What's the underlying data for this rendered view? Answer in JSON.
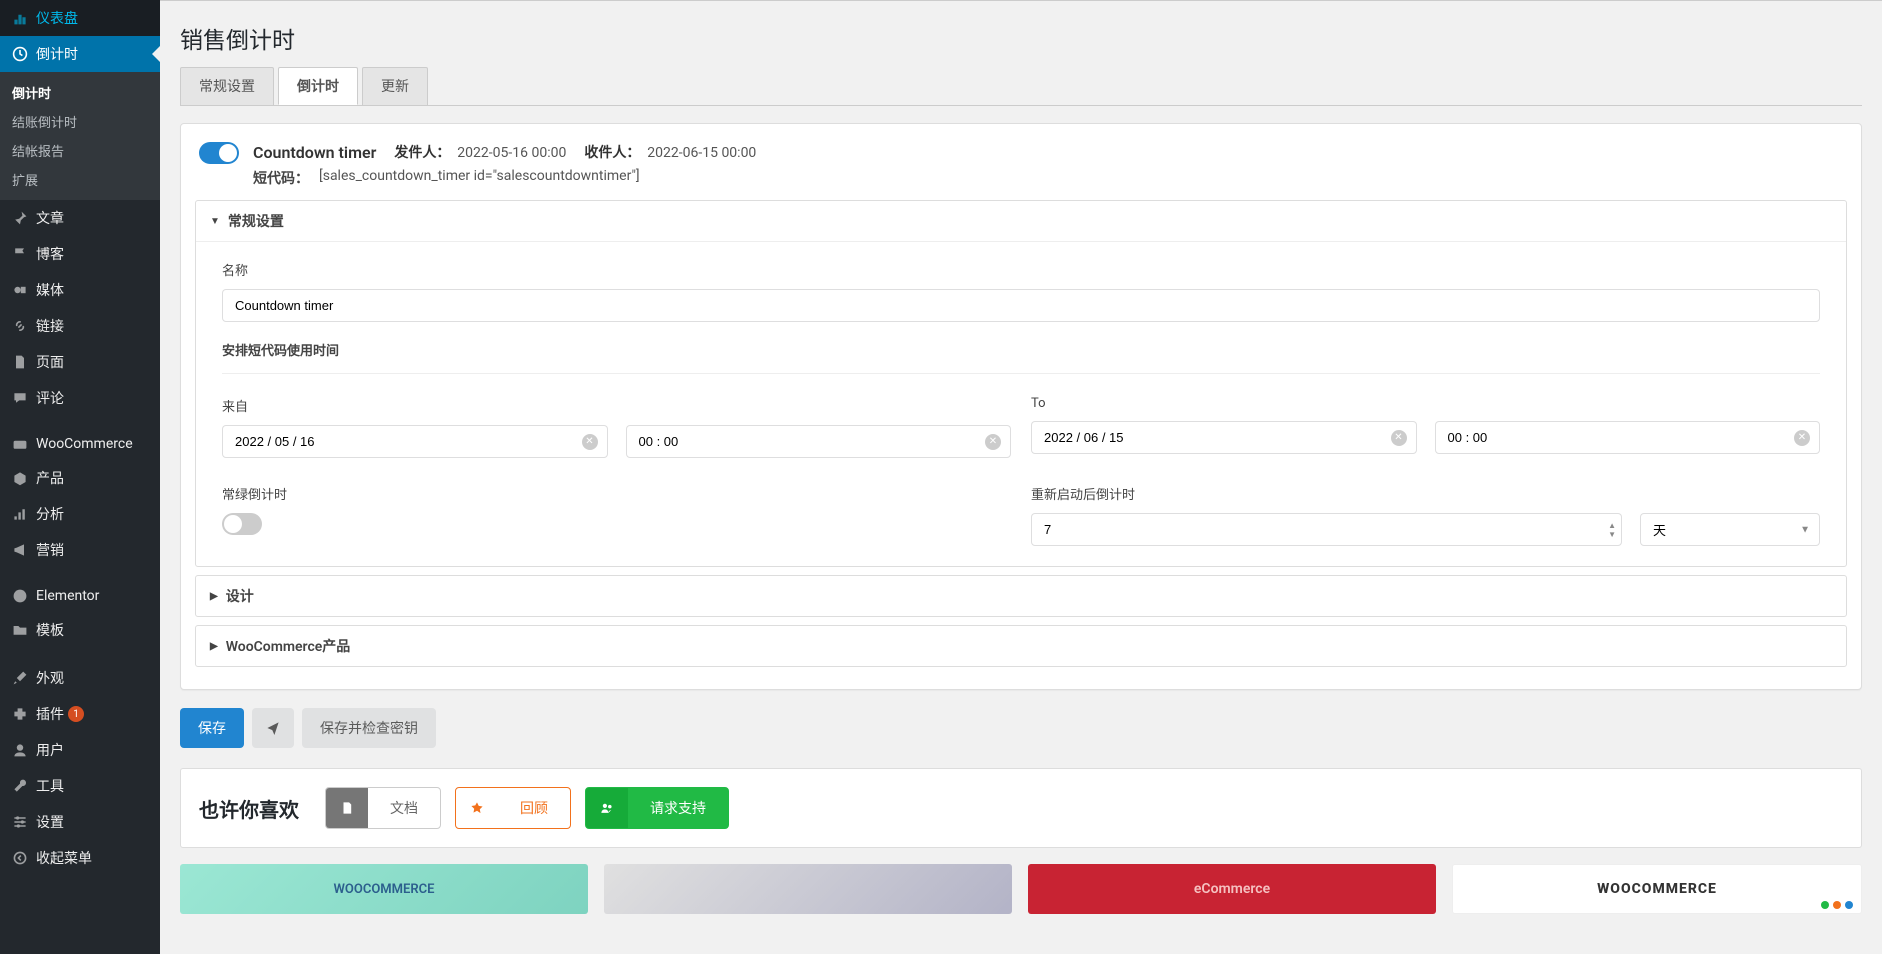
{
  "sidebar": {
    "items": [
      {
        "label": "仪表盘",
        "icon": "dashboard"
      },
      {
        "label": "倒计时",
        "icon": "clock",
        "current": true
      },
      {
        "label": "文章",
        "icon": "pin"
      },
      {
        "label": "博客",
        "icon": "flag"
      },
      {
        "label": "媒体",
        "icon": "media"
      },
      {
        "label": "链接",
        "icon": "link"
      },
      {
        "label": "页面",
        "icon": "page"
      },
      {
        "label": "评论",
        "icon": "comment"
      },
      {
        "label": "WooCommerce",
        "icon": "woo"
      },
      {
        "label": "产品",
        "icon": "product"
      },
      {
        "label": "分析",
        "icon": "analytics"
      },
      {
        "label": "营销",
        "icon": "marketing"
      },
      {
        "label": "Elementor",
        "icon": "elementor"
      },
      {
        "label": "模板",
        "icon": "template"
      },
      {
        "label": "外观",
        "icon": "appearance"
      },
      {
        "label": "插件",
        "icon": "plugin",
        "badge": "1"
      },
      {
        "label": "用户",
        "icon": "user"
      },
      {
        "label": "工具",
        "icon": "tool"
      },
      {
        "label": "设置",
        "icon": "settings"
      },
      {
        "label": "收起菜单",
        "icon": "collapse"
      }
    ],
    "submenu": [
      {
        "label": "倒计时",
        "active": true
      },
      {
        "label": "结账倒计时"
      },
      {
        "label": "结帐报告"
      },
      {
        "label": "扩展"
      }
    ]
  },
  "page": {
    "title": "销售倒计时"
  },
  "tabs": [
    {
      "label": "常规设置"
    },
    {
      "label": "倒计时",
      "active": true
    },
    {
      "label": "更新"
    }
  ],
  "timer": {
    "title": "Countdown timer",
    "from_label": "发件人：",
    "from_value": "2022-05-16  00:00",
    "to_label": "收件人：",
    "to_value": "2022-06-15  00:00",
    "shortcode_label": "短代码：",
    "shortcode_value": "[sales_countdown_timer id=\"salescountdowntimer\"]"
  },
  "sections": {
    "general": {
      "title": "常规设置",
      "name_label": "名称",
      "name_value": "Countdown timer",
      "schedule_label": "安排短代码使用时间",
      "from_label": "来自",
      "from_date": "2022 / 05 / 16",
      "from_time": "00 : 00",
      "to_label": "To",
      "to_date": "2022 / 06 / 15",
      "to_time": "00 : 00",
      "evergreen_label": "常绿倒计时",
      "restart_label": "重新启动后倒计时",
      "restart_value": "7",
      "restart_unit": "天"
    },
    "design": {
      "title": "设计"
    },
    "woo": {
      "title": "WooCommerce产品"
    }
  },
  "buttons": {
    "save": "保存",
    "save_check": "保存并检查密钥"
  },
  "footer": {
    "title": "也许你喜欢",
    "docs": "文档",
    "review": "回顾",
    "support": "请求支持"
  },
  "promos": {
    "p1": "WOOCOMMERCE",
    "p3": "eCommerce",
    "p4": "WOOCOMMERCE"
  }
}
